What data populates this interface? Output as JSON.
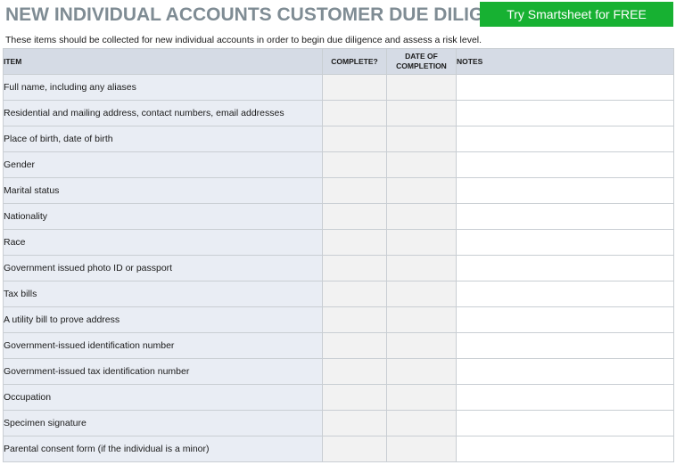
{
  "header": {
    "title": "NEW INDIVIDUAL ACCOUNTS CUSTOMER DUE DILIGENCE",
    "cta_label": "Try Smartsheet for FREE",
    "cta_color": "#17b132"
  },
  "intro": "These items should be collected for new individual accounts in order to begin due diligence and assess a risk level.",
  "table": {
    "columns": {
      "item": "ITEM",
      "complete": "COMPLETE?",
      "date_line1": "DATE OF",
      "date_line2": "COMPLETION",
      "notes": "NOTES"
    },
    "rows": [
      {
        "item": "Full name, including any aliases",
        "complete": "",
        "date": "",
        "notes": ""
      },
      {
        "item": "Residential and mailing address, contact numbers, email addresses",
        "complete": "",
        "date": "",
        "notes": ""
      },
      {
        "item": "Place of birth, date of birth",
        "complete": "",
        "date": "",
        "notes": ""
      },
      {
        "item": "Gender",
        "complete": "",
        "date": "",
        "notes": ""
      },
      {
        "item": "Marital status",
        "complete": "",
        "date": "",
        "notes": ""
      },
      {
        "item": "Nationality",
        "complete": "",
        "date": "",
        "notes": ""
      },
      {
        "item": "Race",
        "complete": "",
        "date": "",
        "notes": ""
      },
      {
        "item": "Government issued photo ID or passport",
        "complete": "",
        "date": "",
        "notes": ""
      },
      {
        "item": "Tax bills",
        "complete": "",
        "date": "",
        "notes": ""
      },
      {
        "item": "A utility bill to prove address",
        "complete": "",
        "date": "",
        "notes": ""
      },
      {
        "item": "Government-issued identification number",
        "complete": "",
        "date": "",
        "notes": ""
      },
      {
        "item": "Government-issued tax identification number",
        "complete": "",
        "date": "",
        "notes": ""
      },
      {
        "item": "Occupation",
        "complete": "",
        "date": "",
        "notes": ""
      },
      {
        "item": "Specimen signature",
        "complete": "",
        "date": "",
        "notes": ""
      },
      {
        "item": "Parental consent form (if the individual is a minor)",
        "complete": "",
        "date": "",
        "notes": ""
      }
    ]
  }
}
